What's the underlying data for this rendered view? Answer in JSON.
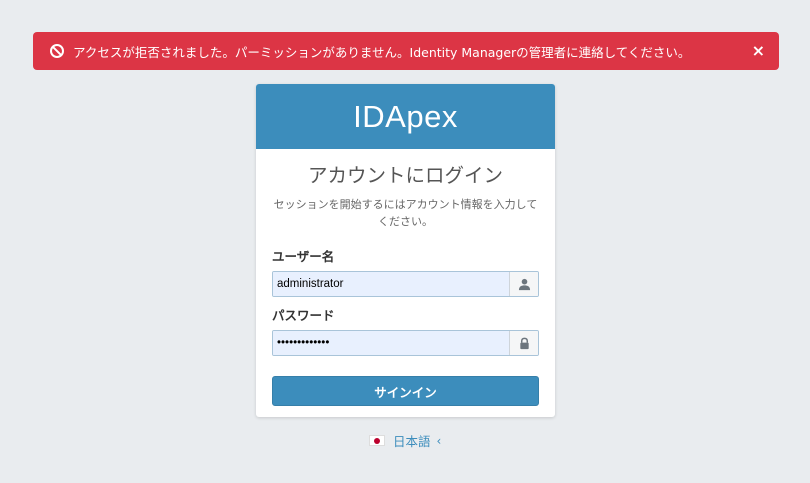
{
  "alert": {
    "icon": "ban-icon",
    "message": "アクセスが拒否されました。パーミッションがありません。Identity Managerの管理者に連絡してください。",
    "close_label": "×",
    "color": "#dc3545"
  },
  "login": {
    "brand": "IDApex",
    "title": "アカウントにログイン",
    "subtitle": "セッションを開始するにはアカウント情報を入力してください。",
    "username_label": "ユーザー名",
    "username_value": "administrator",
    "username_icon": "user-icon",
    "password_label": "パスワード",
    "password_value": "•••••••••••••",
    "password_icon": "lock-icon",
    "signin_label": "サインイン",
    "accent_color": "#3c8dbc"
  },
  "language": {
    "flag": "japan-flag-icon",
    "label": "日本語",
    "caret": "‹"
  }
}
